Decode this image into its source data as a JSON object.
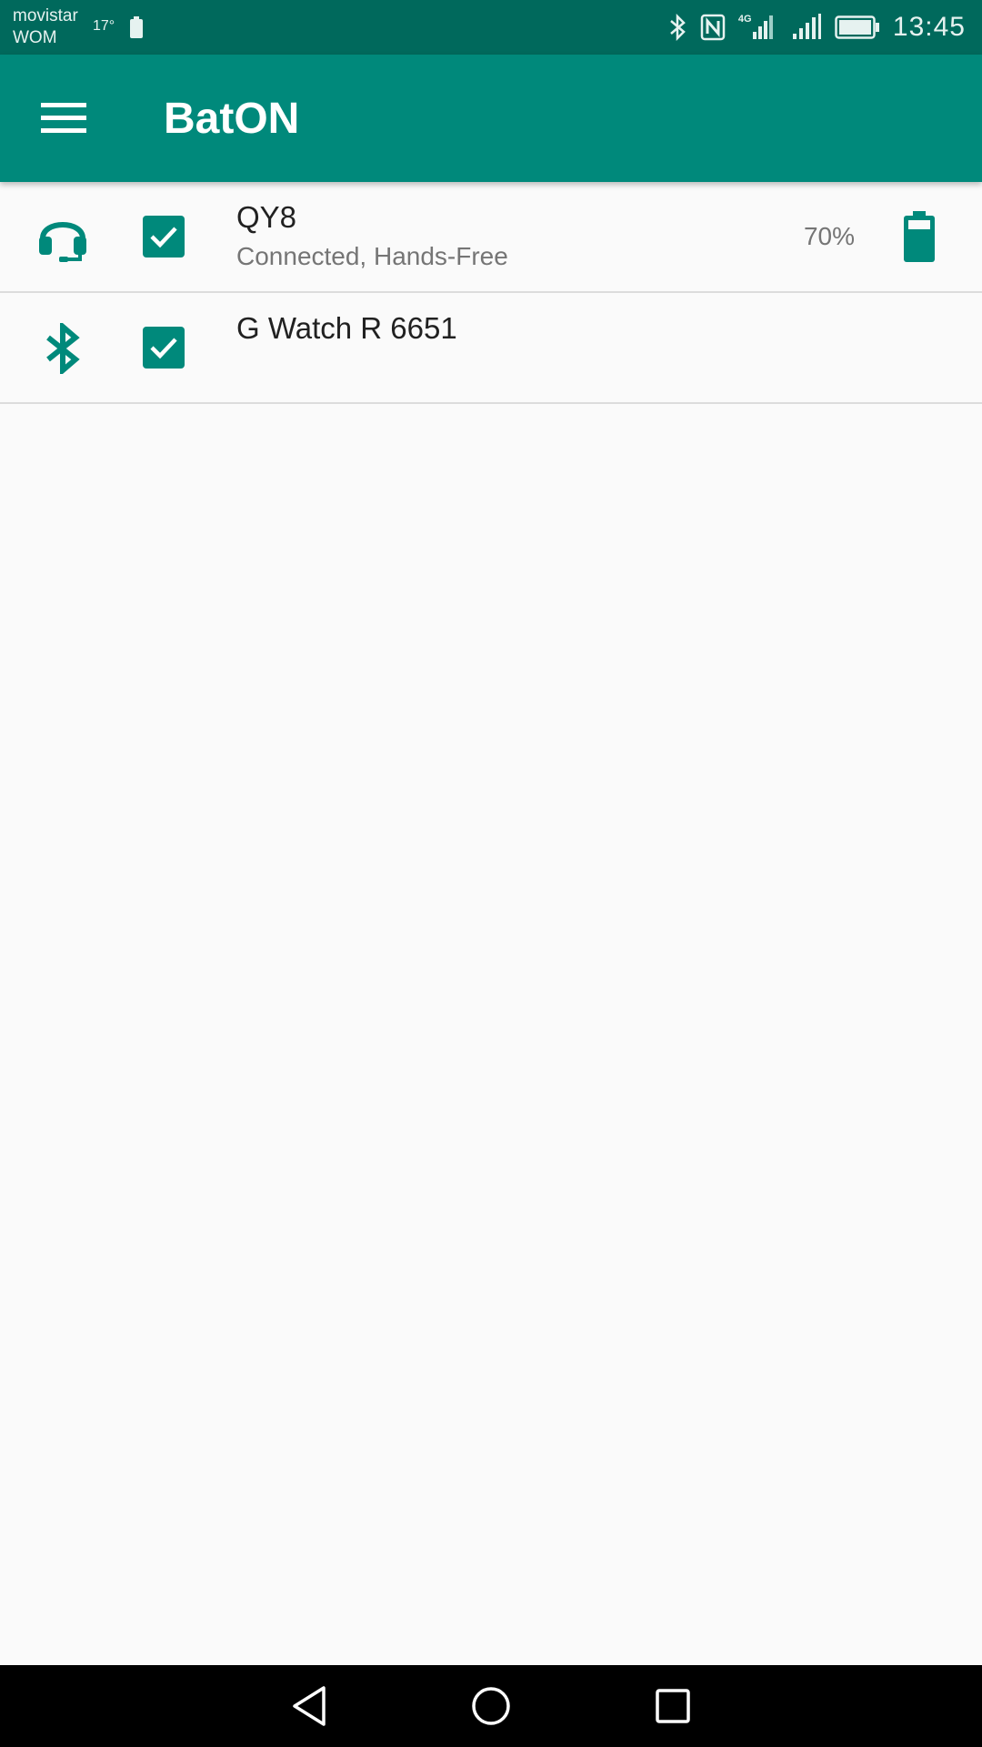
{
  "status_bar": {
    "carrier_line1": "movistar",
    "carrier_line2": "WOM",
    "temperature": "17°",
    "network_type": "4G",
    "time": "13:45"
  },
  "app_bar": {
    "title": "BatON",
    "menu_icon": "hamburger-menu-icon"
  },
  "devices": [
    {
      "icon": "headset-icon",
      "checked": true,
      "name": "QY8",
      "status": "Connected, Hands-Free",
      "battery_percent": "70%",
      "battery_level": 0.7
    },
    {
      "icon": "bluetooth-icon",
      "checked": true,
      "name": "G Watch R 6651",
      "status": "",
      "battery_percent": ""
    }
  ],
  "nav_bar": {
    "back_icon": "back-triangle-icon",
    "home_icon": "home-circle-icon",
    "recents_icon": "recents-square-icon"
  },
  "colors": {
    "status_bar": "#00695c",
    "primary": "#00897b",
    "background": "#fafafa",
    "nav_bar": "#000000"
  }
}
